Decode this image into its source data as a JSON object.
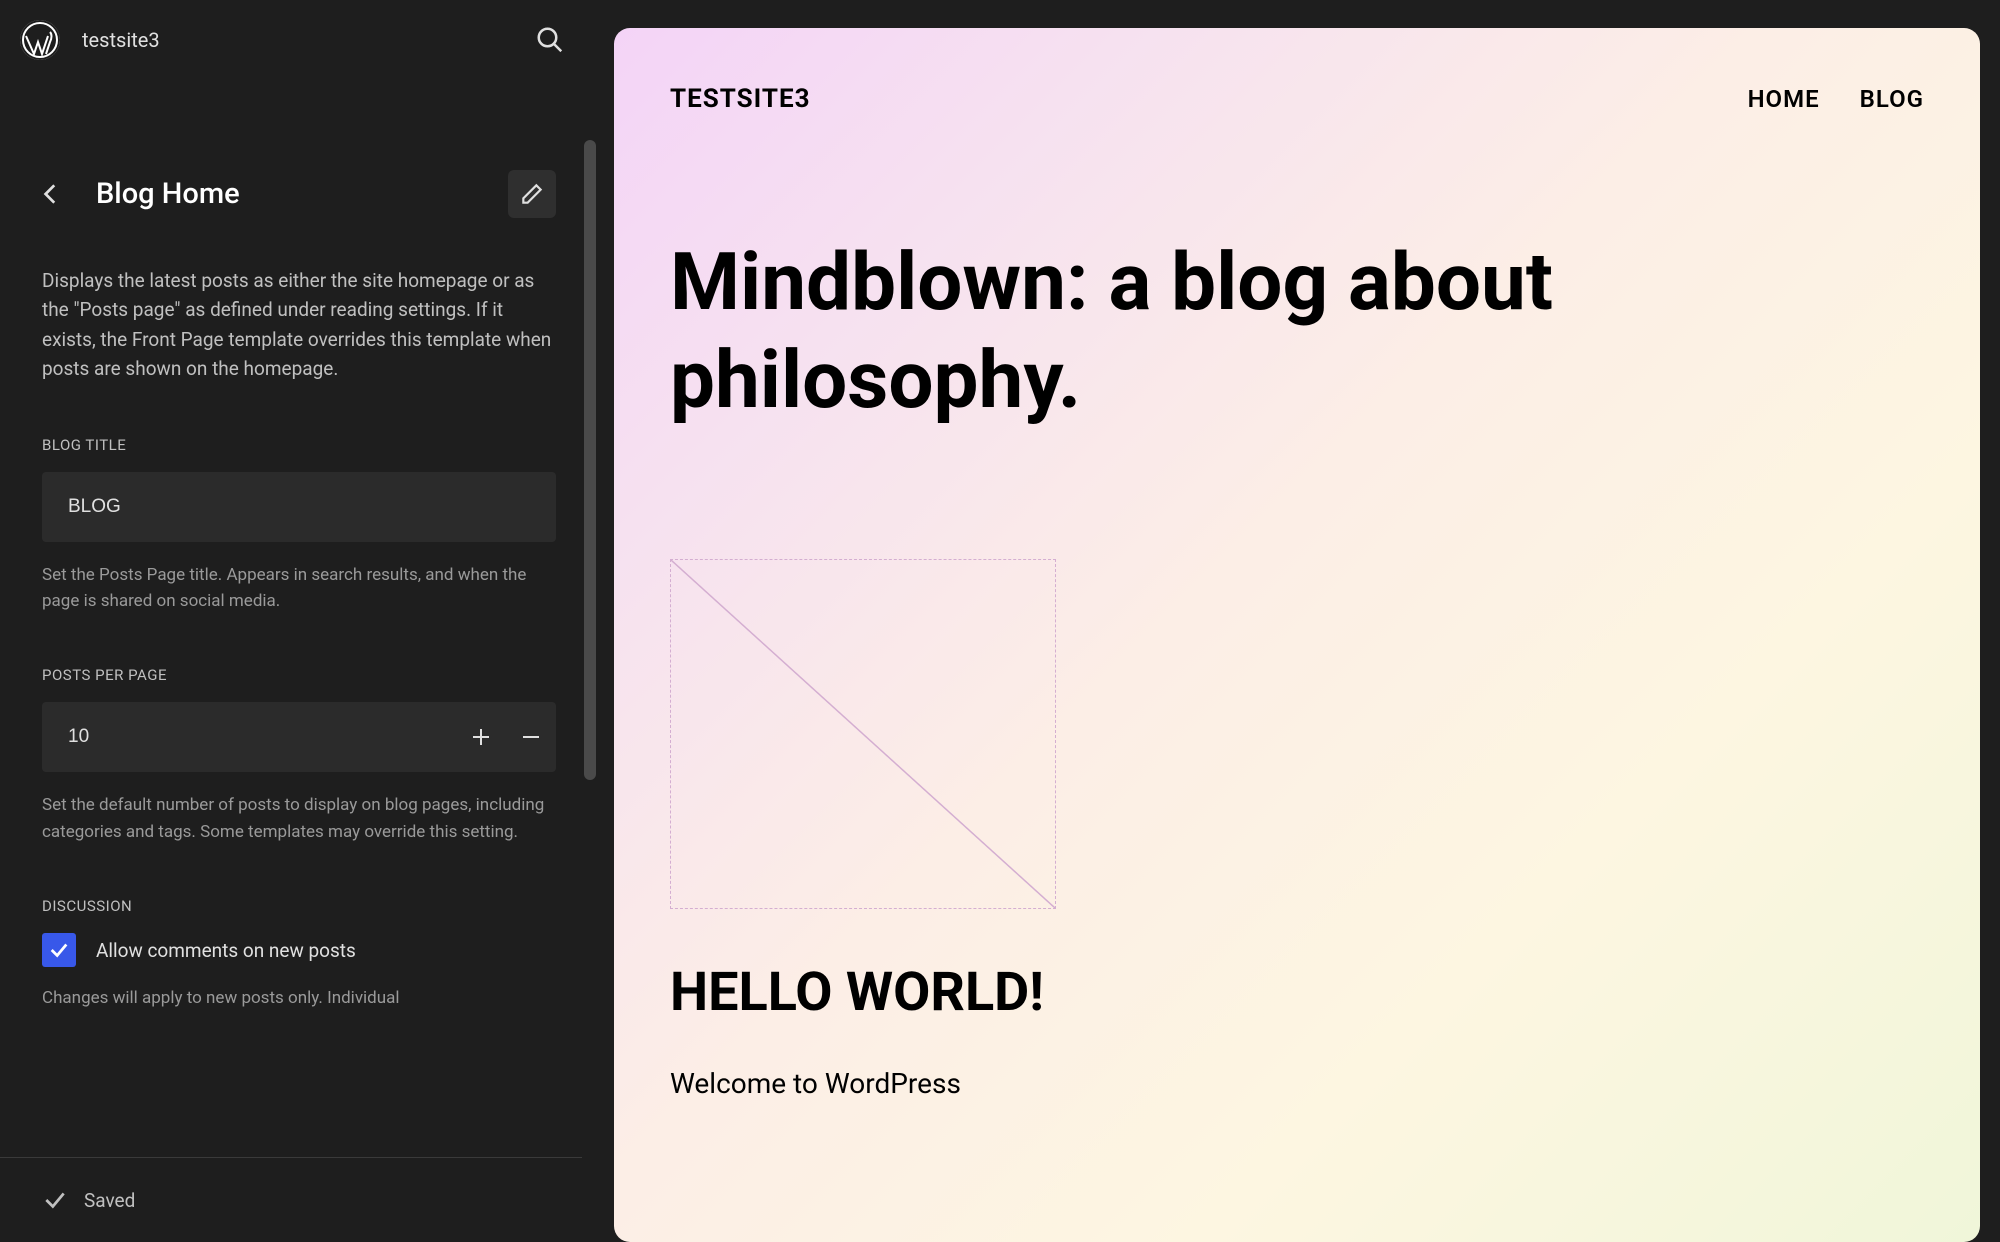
{
  "site": {
    "name": "testsite3"
  },
  "panel": {
    "title": "Blog Home",
    "description": "Displays the latest posts as either the site homepage or as the \"Posts page\" as defined under reading settings. If it exists, the Front Page template overrides this template when posts are shown on the homepage."
  },
  "blog_title": {
    "label": "BLOG TITLE",
    "value": "BLOG",
    "help": "Set the Posts Page title. Appears in search results, and when the page is shared on social media."
  },
  "posts_per_page": {
    "label": "POSTS PER PAGE",
    "value": "10",
    "help": "Set the default number of posts to display on blog pages, including categories and tags. Some templates may override this setting."
  },
  "discussion": {
    "label": "DISCUSSION",
    "checkbox_label": "Allow comments on new posts",
    "help": "Changes will apply to new posts only. Individual"
  },
  "saved": {
    "label": "Saved"
  },
  "preview": {
    "site_title": "TESTSITE3",
    "nav": {
      "home": "HOME",
      "blog": "BLOG"
    },
    "hero": "Mindblown: a blog about philosophy.",
    "post_title": "HELLO WORLD!",
    "post_body": "Welcome to WordPress"
  }
}
